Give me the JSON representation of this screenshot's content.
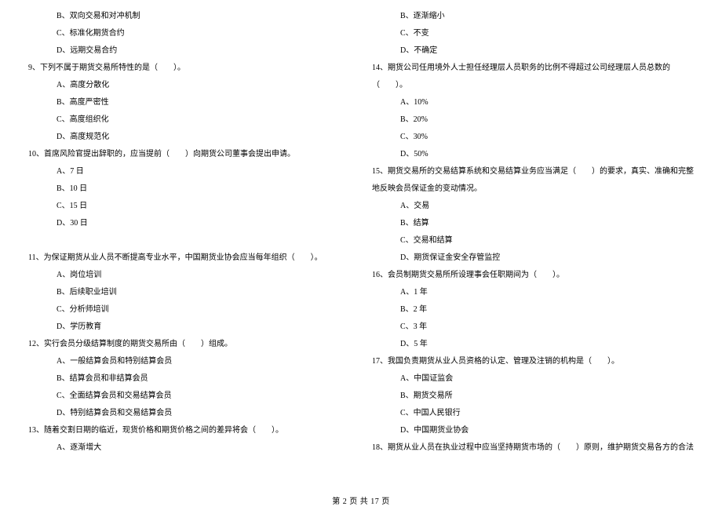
{
  "left": {
    "q_pre_opts": [
      "B、双向交易和对冲机制",
      "C、标准化期货合约",
      "D、远期交易合约"
    ],
    "q9": "9、下列不属于期货交易所特性的是（　　）。",
    "q9_opts": [
      "A、高度分散化",
      "B、高度严密性",
      "C、高度组织化",
      "D、高度规范化"
    ],
    "q10": "10、首席风险官提出辞职的，应当提前（　　）向期货公司董事会提出申请。",
    "q10_opts": [
      "A、7 日",
      "B、10 日",
      "C、15 日",
      "D、30 日"
    ],
    "q11": "11、为保证期货从业人员不断提高专业水平，中国期货业协会应当每年组织（　　）。",
    "q11_opts": [
      "A、岗位培训",
      "B、后续职业培训",
      "C、分析师培训",
      "D、学历教育"
    ],
    "q12": "12、实行会员分级结算制度的期货交易所由（　　）组成。",
    "q12_opts": [
      "A、一般结算会员和特别结算会员",
      "B、结算会员和非结算会员",
      "C、全面结算会员和交易结算会员",
      "D、特别结算会员和交易结算会员"
    ],
    "q13": "13、随着交割日期的临近，现货价格和期货价格之间的差异将会（　　）。",
    "q13_opts": [
      "A、逐渐增大"
    ]
  },
  "right": {
    "q_pre_opts": [
      "B、逐渐缩小",
      "C、不变",
      "D、不确定"
    ],
    "q14": "14、期货公司任用境外人士担任经理层人员职务的比例不得超过公司经理层人员总数的",
    "q14_l2": "（　　）。",
    "q14_opts": [
      "A、10%",
      "B、20%",
      "C、30%",
      "D、50%"
    ],
    "q15": "15、期货交易所的交易结算系统和交易结算业务应当满足（　　）的要求，真实、准确和完整",
    "q15_l2": "地反映会员保证金的变动情况。",
    "q15_opts": [
      "A、交易",
      "B、结算",
      "C、交易和结算",
      "D、期货保证金安全存管监控"
    ],
    "q16": "16、会员制期货交易所所设理事会任职期间为（　　）。",
    "q16_opts": [
      "A、1 年",
      "B、2 年",
      "C、3 年",
      "D、5 年"
    ],
    "q17": "17、我国负责期货从业人员资格的认定、管理及注销的机构是（　　）。",
    "q17_opts": [
      "A、中国证监会",
      "B、期货交易所",
      "C、中国人民银行",
      "D、中国期货业协会"
    ],
    "q18": "18、期货从业人员在执业过程中应当坚持期货市场的（　　）原则，维护期货交易各方的合法"
  },
  "footer": "第 2 页 共 17 页"
}
